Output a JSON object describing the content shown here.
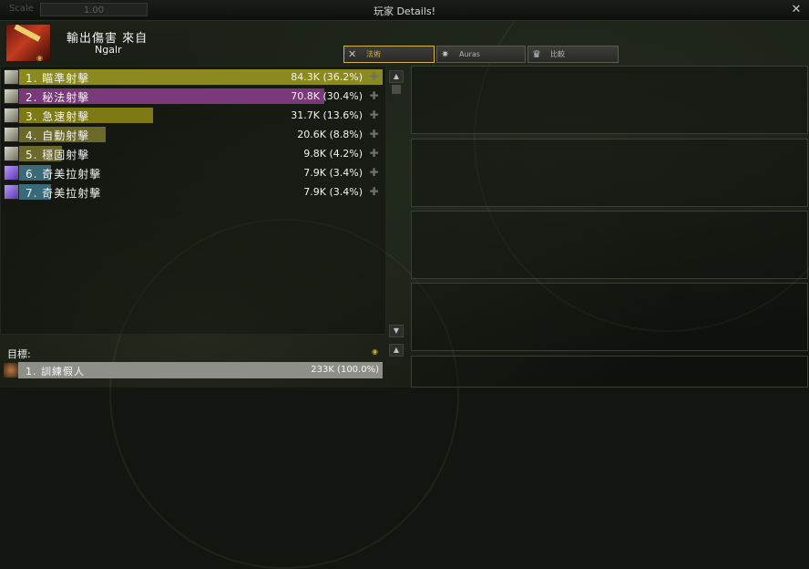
{
  "window": {
    "scale_label": "Scale",
    "scale_value": "1.00",
    "title": "玩家 Details!",
    "close_icon": "close-icon"
  },
  "player": {
    "title": "輸出傷害 來自",
    "name": "Ngalr",
    "icon": "hunter-class-icon",
    "report_icon": "report-icon"
  },
  "tabs": [
    {
      "label": "法術",
      "icon": "spells-icon",
      "active": true
    },
    {
      "label": "Auras",
      "icon": "auras-icon",
      "active": false
    },
    {
      "label": "比較",
      "icon": "crown-icon",
      "active": false
    }
  ],
  "spells": [
    {
      "label": "1. 瞄準射擊",
      "value": "84.3K (36.2%)",
      "fill": 1.0,
      "color": "#8a8a1e",
      "icon": "aimed-shot-icon"
    },
    {
      "label": "2. 秘法射擊",
      "value": "70.8K (30.4%)",
      "fill": 0.84,
      "color": "#7a3a7a",
      "icon": "arcane-shot-icon"
    },
    {
      "label": "3. 急速射擊",
      "value": "31.7K (13.6%)",
      "fill": 0.37,
      "color": "#7d7a14",
      "icon": "rapid-fire-icon"
    },
    {
      "label": "4. 自動射擊",
      "value": "20.6K (8.8%)",
      "fill": 0.24,
      "color": "#6b6a2a",
      "icon": "auto-shot-icon"
    },
    {
      "label": "5. 穩固射擊",
      "value": "9.8K (4.2%)",
      "fill": 0.12,
      "color": "#6b6a2a",
      "icon": "steady-shot-icon"
    },
    {
      "label": "6. 奇美拉射擊",
      "value": "7.9K (3.4%)",
      "fill": 0.09,
      "color": "#3a6a7a",
      "icon": "chimera-shot-icon"
    },
    {
      "label": "7. 奇美拉射擊",
      "value": "7.9K (3.4%)",
      "fill": 0.09,
      "color": "#3a6a7a",
      "icon": "chimera-shot-icon"
    }
  ],
  "target": {
    "label": "目標:",
    "report_icon": "report-icon",
    "rows": [
      {
        "label": "1. 訓練假人",
        "value": "233K (100.0%)",
        "icon": "skull-icon"
      }
    ]
  }
}
